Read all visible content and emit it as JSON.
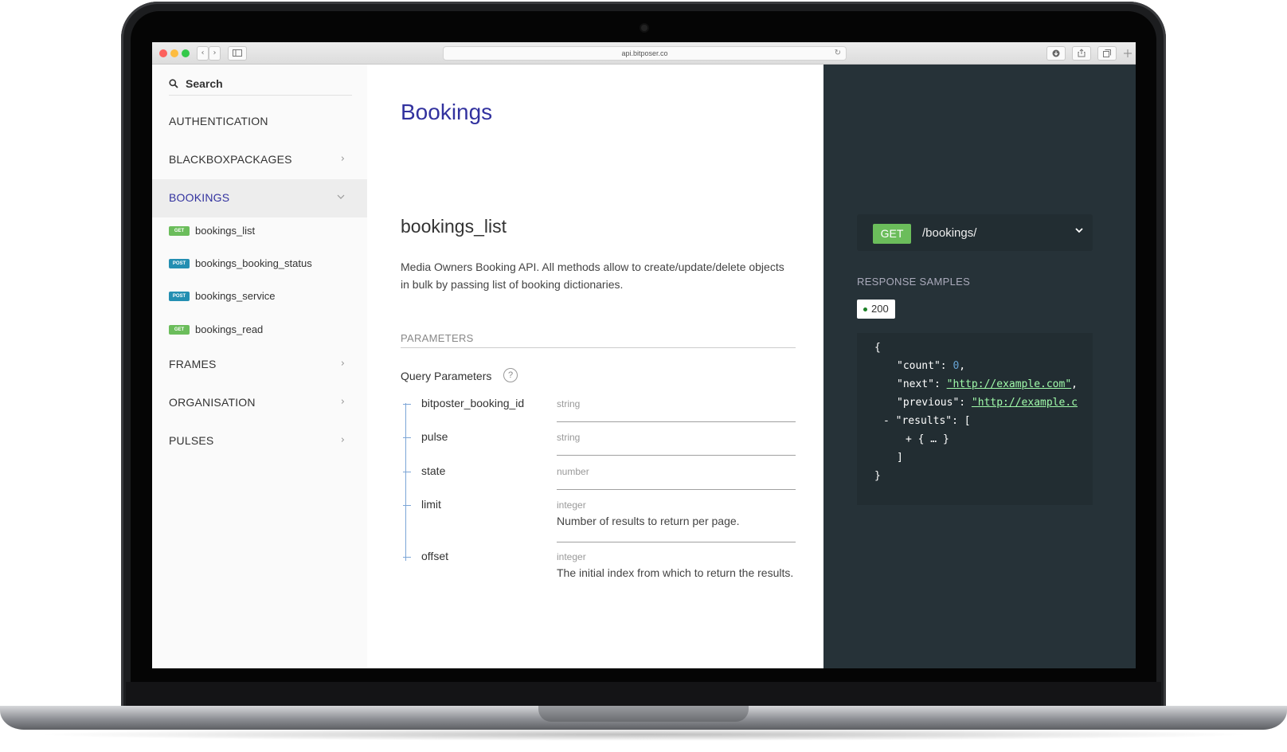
{
  "browser": {
    "url": "api.bitposer.co",
    "nav_back": "‹",
    "nav_forward": "›"
  },
  "sidebar": {
    "search_label": "Search",
    "sections": [
      {
        "label": "AUTHENTICATION"
      },
      {
        "label": "BLACKBOXPACKAGES"
      },
      {
        "label": "BOOKINGS"
      },
      {
        "label": "FRAMES"
      },
      {
        "label": "ORGANISATION"
      },
      {
        "label": "PULSES"
      }
    ],
    "operations": [
      {
        "method": "GET",
        "name": "bookings_list"
      },
      {
        "method": "POST",
        "name": "bookings_booking_status"
      },
      {
        "method": "POST",
        "name": "bookings_service"
      },
      {
        "method": "GET",
        "name": "bookings_read"
      }
    ]
  },
  "main": {
    "section_title": "Bookings",
    "operation_title": "bookings_list",
    "description": "Media Owners Booking API. All methods allow to create/update/delete objects in bulk by passing list of booking dictionaries.",
    "parameters_heading": "PARAMETERS",
    "query_params_label": "Query Parameters",
    "help_glyph": "?",
    "params": [
      {
        "name": "bitposter_booking_id",
        "type": "string",
        "desc": ""
      },
      {
        "name": "pulse",
        "type": "string",
        "desc": ""
      },
      {
        "name": "state",
        "type": "number",
        "desc": ""
      },
      {
        "name": "limit",
        "type": "integer",
        "desc": "Number of results to return per page."
      },
      {
        "name": "offset",
        "type": "integer",
        "desc": "The initial index from which to return the results."
      }
    ]
  },
  "right": {
    "method": "GET",
    "path": "/bookings/",
    "response_heading": "RESPONSE SAMPLES",
    "status_code": "200",
    "code": {
      "open_brace": "{",
      "count_key": "\"count\": ",
      "count_val": "0",
      "next_key": "\"next\": ",
      "next_val": "\"http://example.com\"",
      "previous_key": "\"previous\": ",
      "previous_val": "\"http://example.c",
      "results_key": "- \"results\": [",
      "results_item": "+ { … }",
      "close_bracket": "]",
      "close_brace": "}"
    },
    "colors": {
      "pane": "#263238",
      "get": "#6bbd5b",
      "post": "#248fb2",
      "accent": "#32329f"
    }
  }
}
